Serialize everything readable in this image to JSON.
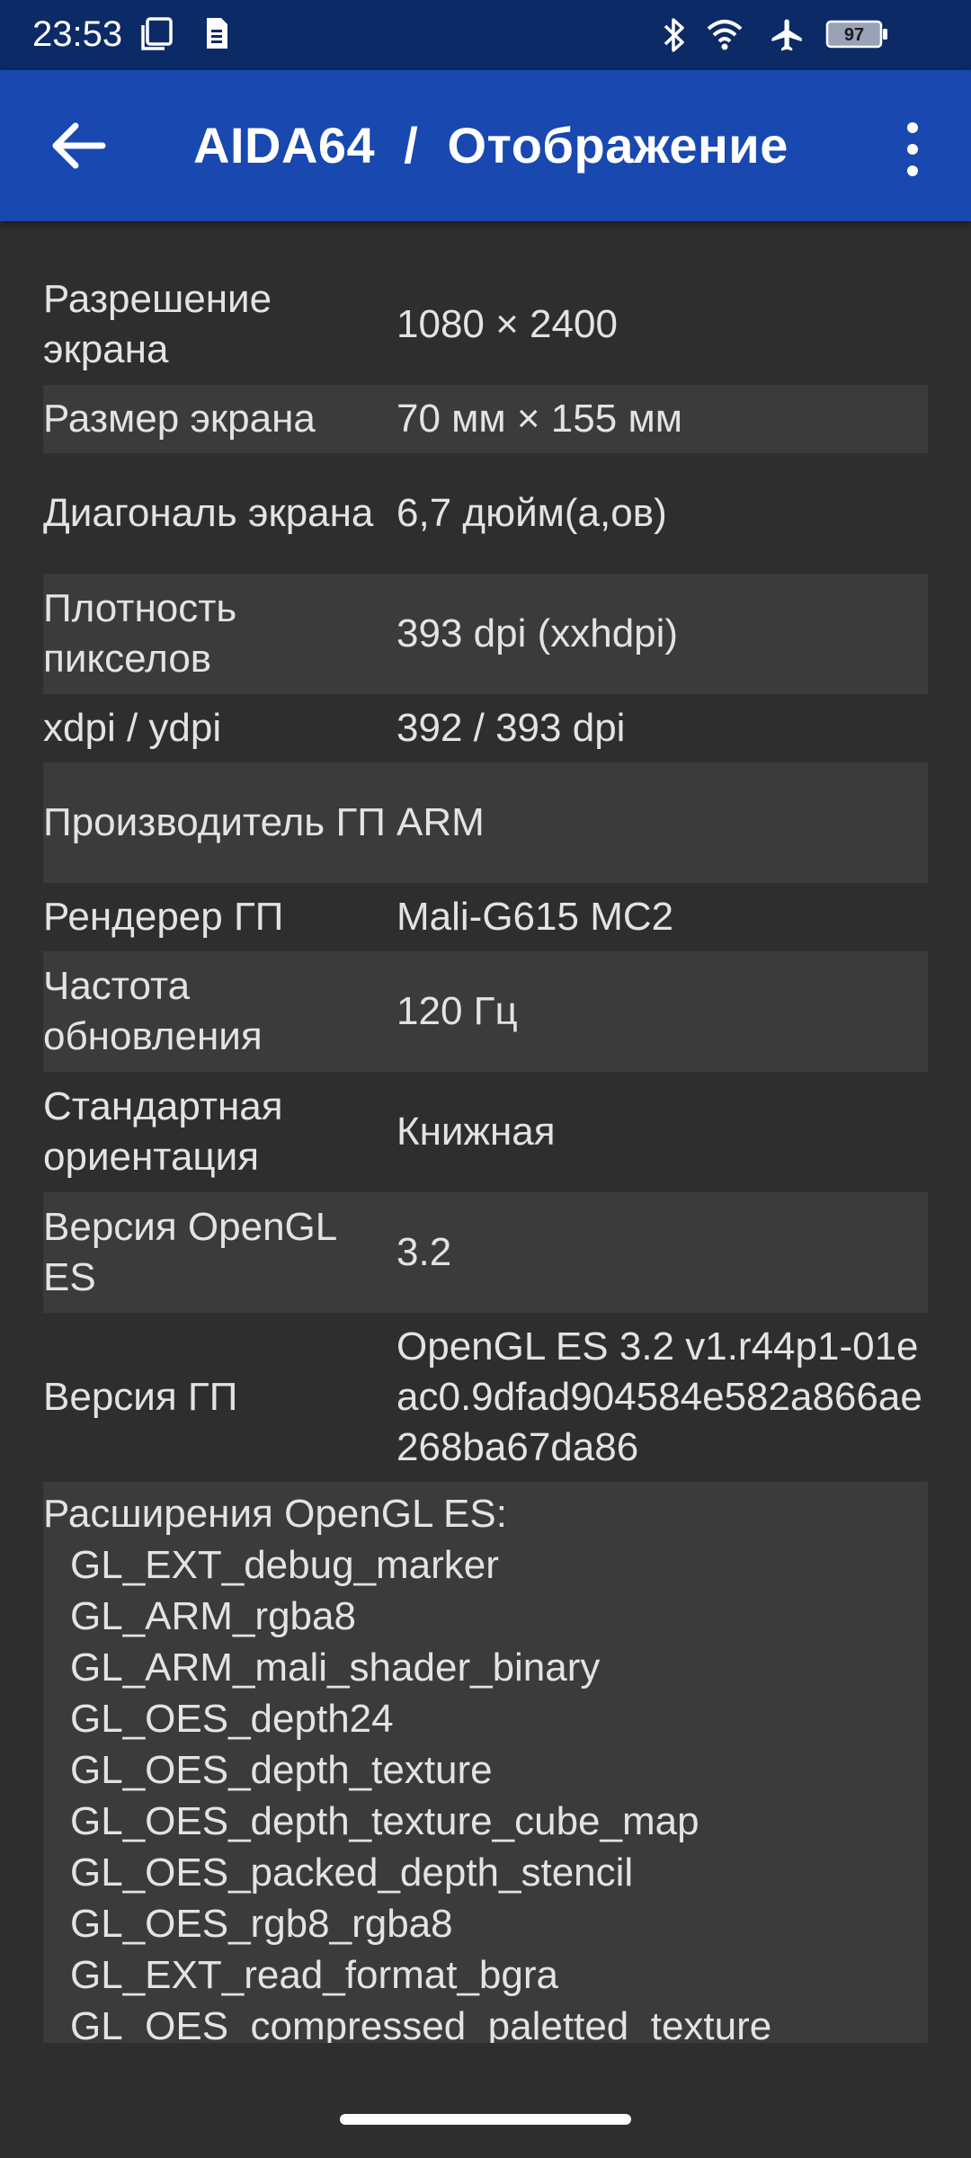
{
  "status_bar": {
    "time": "23:53",
    "battery_level": "97",
    "icons": [
      "screenshot-icon",
      "sim-card-icon",
      "bluetooth-icon",
      "wifi-icon",
      "airplane-icon",
      "battery-icon"
    ]
  },
  "app_bar": {
    "title": "AIDA64  /  Отображение",
    "back_icon": "arrow-left-icon",
    "menu_icon": "more-vert-icon"
  },
  "colors": {
    "status_bar": "#0c2a66",
    "app_bar": "#1848b0",
    "background": "#2e2e2e",
    "row_alt": "#3b3b3b",
    "text": "#e3e3e3"
  },
  "rows": [
    {
      "label": "Разрешение экрана",
      "value": "1080 × 2400"
    },
    {
      "label": "Размер экрана",
      "value": "70 мм × 155 мм"
    },
    {
      "label": "Диагональ экрана",
      "value": "6,7 дюйм(а,ов)"
    },
    {
      "label": "Плотность пикселов",
      "value": "393 dpi (xxhdpi)"
    },
    {
      "label": "xdpi / ydpi",
      "value": "392 / 393 dpi"
    },
    {
      "label": "Производитель ГП",
      "value": "ARM"
    },
    {
      "label": "Рендерер ГП",
      "value": "Mali-G615 MC2"
    },
    {
      "label": "Частота обновления",
      "value": "120 Гц"
    },
    {
      "label": "Стандартная ориентация",
      "value": "Книжная"
    },
    {
      "label": "Версия OpenGL ES",
      "value": "3.2"
    },
    {
      "label": "Версия ГП",
      "value": "OpenGL ES 3.2 v1.r44p1-01eac0.9dfad904584e582a866ae268ba67da86"
    }
  ],
  "extensions": {
    "title": "Расширения OpenGL ES:",
    "items": [
      "GL_EXT_debug_marker",
      "GL_ARM_rgba8",
      "GL_ARM_mali_shader_binary",
      "GL_OES_depth24",
      "GL_OES_depth_texture",
      "GL_OES_depth_texture_cube_map",
      "GL_OES_packed_depth_stencil",
      "GL_OES_rgb8_rgba8",
      "GL_EXT_read_format_bgra",
      "GL_OES_compressed_paletted_texture"
    ]
  }
}
